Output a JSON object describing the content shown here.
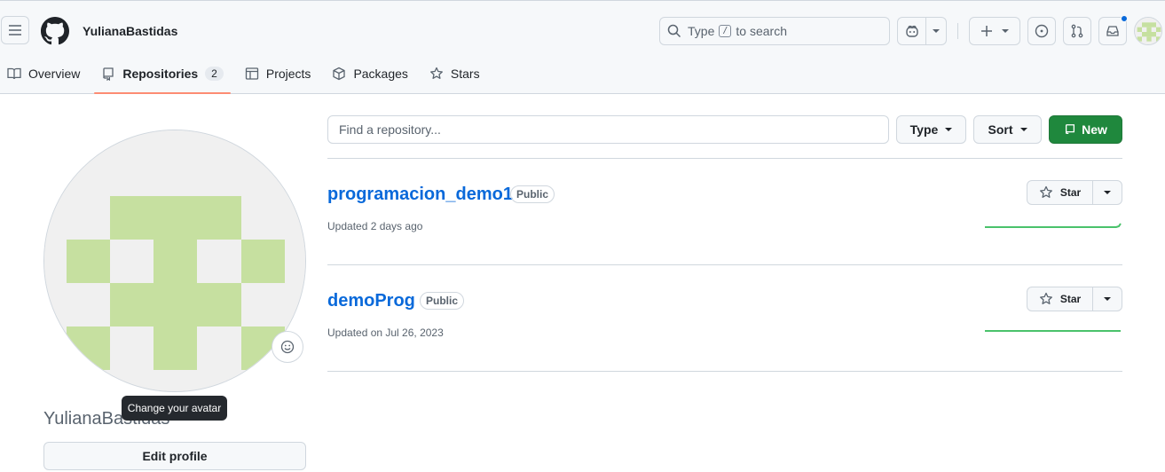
{
  "header": {
    "username": "YulianaBastidas",
    "search_prefix": "Type",
    "search_key": "/",
    "search_suffix": "to search"
  },
  "tabs": [
    {
      "label": "Overview",
      "icon": "book-icon"
    },
    {
      "label": "Repositories",
      "icon": "repo-icon",
      "count": "2",
      "active": true
    },
    {
      "label": "Projects",
      "icon": "table-icon"
    },
    {
      "label": "Packages",
      "icon": "package-icon"
    },
    {
      "label": "Stars",
      "icon": "star-icon"
    }
  ],
  "sidebar": {
    "display_name": "YulianaBastidas",
    "tooltip": "Change your avatar",
    "edit_profile_label": "Edit profile"
  },
  "filters": {
    "find_placeholder": "Find a repository...",
    "type_label": "Type",
    "sort_label": "Sort",
    "new_label": "New"
  },
  "repos": [
    {
      "name": "programacion_demo1",
      "visibility": "Public",
      "updated": "Updated 2 days ago",
      "star_label": "Star"
    },
    {
      "name": "demoProg",
      "visibility": "Public",
      "updated": "Updated on Jul 26, 2023",
      "star_label": "Star"
    }
  ],
  "colors": {
    "accent": "#0969da",
    "primary_button": "#1f883d",
    "tab_underline": "#fd8c73",
    "avatar_fill": "#c6e0a0",
    "sparkline": "#4ac26b"
  }
}
